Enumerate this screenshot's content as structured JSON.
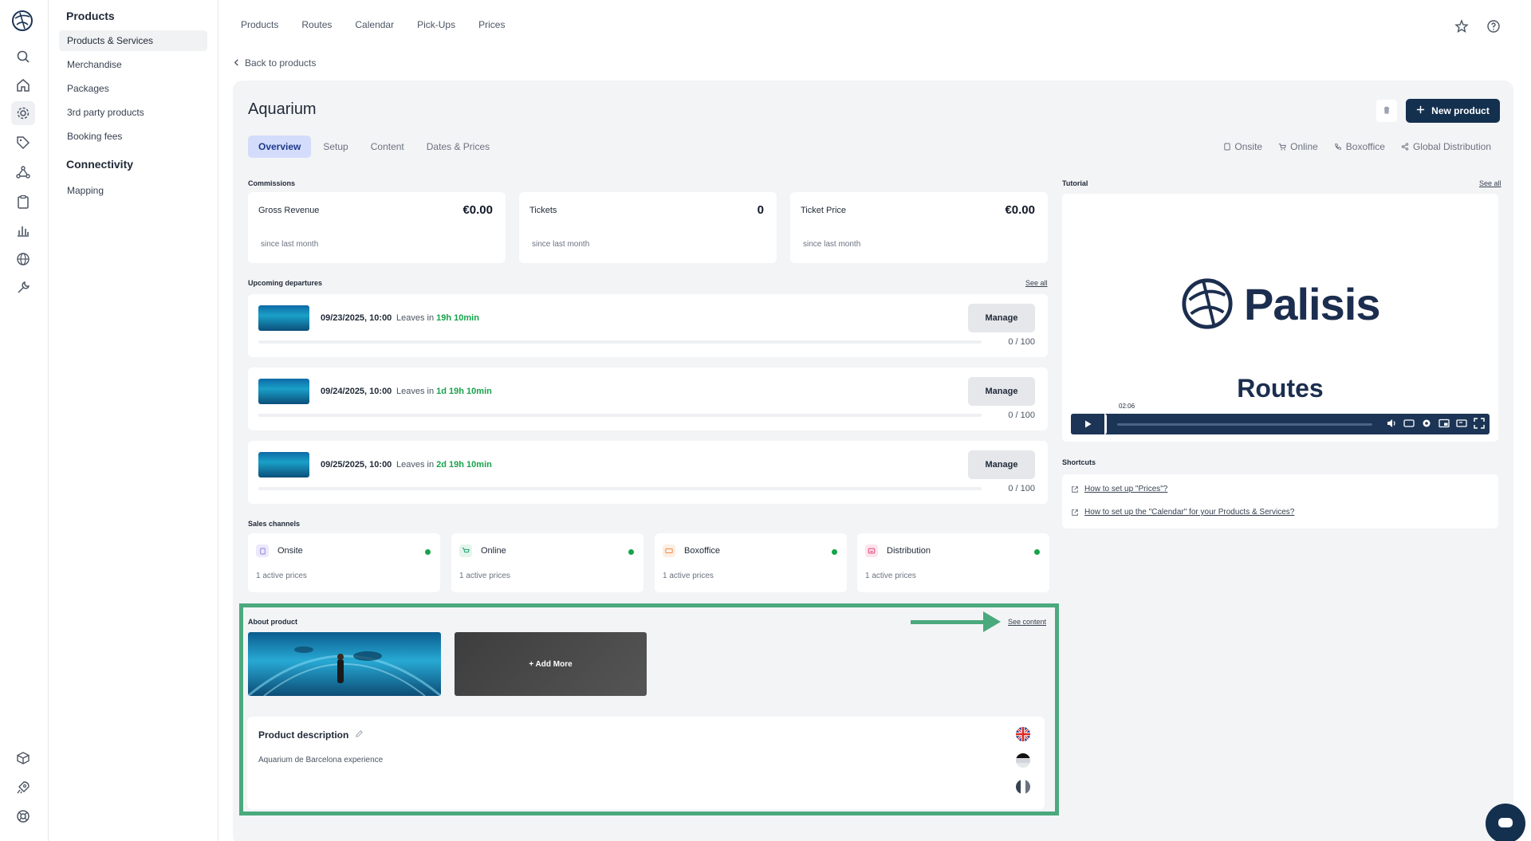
{
  "rail": {
    "items": [
      "search-icon",
      "home-icon",
      "gear-icon",
      "tag-icon",
      "network-icon",
      "clipboard-icon",
      "bar-chart-icon",
      "globe-icon",
      "wrench-icon",
      "cube-icon",
      "rocket-icon",
      "lifebuoy-icon"
    ]
  },
  "subnav": {
    "section1": "Products",
    "items1": [
      "Products & Services",
      "Merchandise",
      "Packages",
      "3rd party products",
      "Booking fees"
    ],
    "section2": "Connectivity",
    "items2": [
      "Mapping"
    ]
  },
  "topnav": [
    "Products",
    "Routes",
    "Calendar",
    "Pick-Ups",
    "Prices"
  ],
  "back_link": "Back to products",
  "product": {
    "title": "Aquarium",
    "new_button": "New product",
    "tabs": [
      "Overview",
      "Setup",
      "Content",
      "Dates & Prices"
    ],
    "active_tab": "Overview",
    "channel_filters": [
      "Onsite",
      "Online",
      "Boxoffice",
      "Global Distribution"
    ]
  },
  "commissions": {
    "label": "Commissions",
    "cards": [
      {
        "label": "Gross Revenue",
        "value": "€0.00",
        "sub": "since last month"
      },
      {
        "label": "Tickets",
        "value": "0",
        "sub": "since last month"
      },
      {
        "label": "Ticket Price",
        "value": "€0.00",
        "sub": "since last month"
      }
    ]
  },
  "departures": {
    "label": "Upcoming departures",
    "see_all": "See all",
    "items": [
      {
        "date": "09/23/2025, 10:00",
        "leaves": "Leaves in",
        "eta": "19h 10min",
        "button": "Manage",
        "count": "0 / 100"
      },
      {
        "date": "09/24/2025, 10:00",
        "leaves": "Leaves in",
        "eta": "1d 19h 10min",
        "button": "Manage",
        "count": "0 / 100"
      },
      {
        "date": "09/25/2025, 10:00",
        "leaves": "Leaves in",
        "eta": "2d 19h 10min",
        "button": "Manage",
        "count": "0 / 100"
      }
    ]
  },
  "sales_channels": {
    "label": "Sales channels",
    "items": [
      {
        "name": "Onsite",
        "sub": "1 active prices",
        "color": "#8b7fd6"
      },
      {
        "name": "Online",
        "sub": "1 active prices",
        "color": "#22a06b"
      },
      {
        "name": "Boxoffice",
        "sub": "1 active prices",
        "color": "#f08a4b"
      },
      {
        "name": "Distribution",
        "sub": "1 active prices",
        "color": "#e0457b"
      }
    ]
  },
  "about": {
    "label": "About product",
    "see_content": "See content",
    "add_more": "+ Add More",
    "description_title": "Product description",
    "description_text": "Aquarium de Barcelona experience"
  },
  "tutorial": {
    "label": "Tutorial",
    "see_all": "See all",
    "logo_text": "Palisis",
    "subtitle": "Routes",
    "time": "02:06"
  },
  "shortcuts": {
    "label": "Shortcuts",
    "links": [
      "How to set up \"Prices\"?",
      "How to set up the \"Calendar\" for your Products & Services?"
    ]
  },
  "colors": {
    "primary": "#14304f",
    "active_tab_bg": "#d3dcfb",
    "success": "#16a34a",
    "highlight": "#4aa97d"
  }
}
